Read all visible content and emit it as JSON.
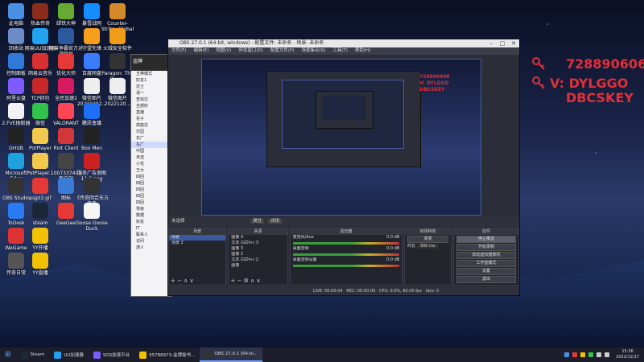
{
  "desktop_icons": [
    {
      "label": "此电脑",
      "color": "#4a90e2"
    },
    {
      "label": "回收站",
      "color": "#6b8cc7"
    },
    {
      "label": "控制面板",
      "color": "#2f79d8"
    },
    {
      "label": "阿里云盘",
      "color": "#7c5cff"
    },
    {
      "label": "2.FVE抽取器",
      "color": "#f2f2f2"
    },
    {
      "label": "GHUB",
      "color": "#222"
    },
    {
      "label": "Microsoft Edge",
      "color": "#1fa1e0"
    },
    {
      "label": "OBS Studio",
      "color": "#333"
    },
    {
      "label": "ToDesk",
      "color": "#2a7bf3"
    },
    {
      "label": "WeGame",
      "color": "#d33"
    },
    {
      "label": "传奇日常",
      "color": "#555"
    },
    {
      "label": "热血传奇",
      "color": "#8b2d1a"
    },
    {
      "label": "网易UU加速器",
      "color": "#22a3f0"
    },
    {
      "label": "网易云音乐",
      "color": "#d93030"
    },
    {
      "label": "TCP抓包",
      "color": "#c62828"
    },
    {
      "label": "微信",
      "color": "#31c44a"
    },
    {
      "label": "PotPlayer",
      "color": "#f2c94c"
    },
    {
      "label": "PotPlayer...",
      "color": "#f2c94c"
    },
    {
      "label": "psjpl3.gif",
      "color": "#e53935"
    },
    {
      "label": "steam",
      "color": "#1b2838"
    },
    {
      "label": "YY开播",
      "color": "#f2c100"
    },
    {
      "label": "YY直播",
      "color": "#f2c100"
    },
    {
      "label": "绿铁大神",
      "color": "#6a3"
    },
    {
      "label": "魔兽争霸官方对战平台",
      "color": "#2d5a9e"
    },
    {
      "label": "优化大师",
      "color": "#e53935"
    },
    {
      "label": "全民加速2",
      "color": "#d81b60"
    },
    {
      "label": "VALORANT",
      "color": "#ff4655"
    },
    {
      "label": "Riot Client",
      "color": "#d13639"
    },
    {
      "label": "1007337403 客户端",
      "color": "#444"
    },
    {
      "label": "图标",
      "color": "#3a7bd5"
    },
    {
      "label": "GeeGee",
      "color": "#e53935"
    },
    {
      "label": "暴雪战网",
      "color": "#148eff"
    },
    {
      "label": "守望先锋",
      "color": "#f99e1a"
    },
    {
      "label": "百度网盘",
      "color": "#3a7bff"
    },
    {
      "label": "微信图片 20221202...",
      "color": "#eee"
    },
    {
      "label": "騰訊會議",
      "color": "#1e6ff7"
    },
    {
      "label": "Boo Men",
      "color": "#222"
    },
    {
      "label": "服务广告测图 11.6.png",
      "color": "#c22"
    },
    {
      "label": "《传奇回合东方传奇",
      "color": "#333"
    },
    {
      "label": "Goose Goose Duck",
      "color": "#f5f5f5"
    },
    {
      "label": "Counter-Strike: Global Off...",
      "color": "#d4892a"
    },
    {
      "label": "火绒安全软件",
      "color": "#f29b1b"
    },
    {
      "label": "Paragon: The Over...",
      "color": "#333"
    },
    {
      "label": "微信图片 2022120...",
      "color": "#eee"
    }
  ],
  "qq_panel": {
    "title": "金牌",
    "rows": [
      "五带模式",
      "好友1",
      "达士",
      "请一",
      "查找达",
      "全部好",
      "直播",
      "花子",
      "高能达",
      "乐园",
      "东广",
      "东广",
      "中国",
      "未选",
      "小花",
      "王大",
      "四回",
      "四回",
      "四回",
      "四回",
      "四回",
      "零级",
      "数据",
      "好友",
      "IT",
      "联系人",
      "访问",
      "游人"
    ]
  },
  "obs": {
    "title": "OBS 27.0.1 (64-bit, windows) - 配置文件: 未命名 - 场景: 未命名",
    "menu": [
      "文件(F)",
      "编辑(E)",
      "视图(V)",
      "停靠窗口(D)",
      "配置文件(P)",
      "场景集合(S)",
      "工具(T)",
      "帮助(H)"
    ],
    "ctrl": {
      "scene_label": "未选择",
      "properties": "属性",
      "filters": "滤镜"
    },
    "docks": {
      "scenes": {
        "title": "场景",
        "items": [
          "场景",
          "场景 2"
        ]
      },
      "sources": {
        "title": "来源",
        "items": [
          "图像 4",
          "文本 (GDI+) 3",
          "图像 3",
          "图像 2",
          "文本 (GDI+) 2",
          "图像"
        ]
      },
      "mixer": {
        "title": "混音器",
        "channels": [
          {
            "name": "麦克风/Aux",
            "level": "0.0 dB"
          },
          {
            "name": "桌面音频",
            "level": "0.0 dB"
          },
          {
            "name": "桌面音频设备",
            "level": "0.0 dB"
          }
        ]
      },
      "transitions": {
        "title": "转场特效",
        "mode": "渐变",
        "duration_label": "时长",
        "duration": "300 ms"
      },
      "controls": {
        "title": "控件",
        "buttons": [
          "停止推流",
          "开始录制",
          "启动虚拟摄像机",
          "工作室模式",
          "设置",
          "退出"
        ]
      }
    },
    "status": {
      "live": "LIVE: 00:00:04",
      "rec": "REC: 00:00:00",
      "cpu": "CPU: 0.0%, 60.00 fps",
      "kbps": "kb/s: 0"
    }
  },
  "overlay": {
    "number": "728890606",
    "line1": "V: DYLGGO",
    "line2": "DBCSKEY",
    "color": "#e0303a"
  },
  "taskbar": {
    "items": [
      {
        "label": "Steam",
        "color": "#1b2838"
      },
      {
        "label": "UU加速器",
        "color": "#22a3f0"
      },
      {
        "label": "SOS加速平台",
        "color": "#7c5cff"
      },
      {
        "label": "55788973-金牌秘书...",
        "color": "#f2c100"
      },
      {
        "label": "OBS 27.0.1 (64-bi...",
        "color": "#333"
      }
    ],
    "time": "15:36",
    "date": "2022/12/17"
  },
  "colors": {
    "obs_accent": "#3a5aa0",
    "overlay": "#e0303a"
  }
}
